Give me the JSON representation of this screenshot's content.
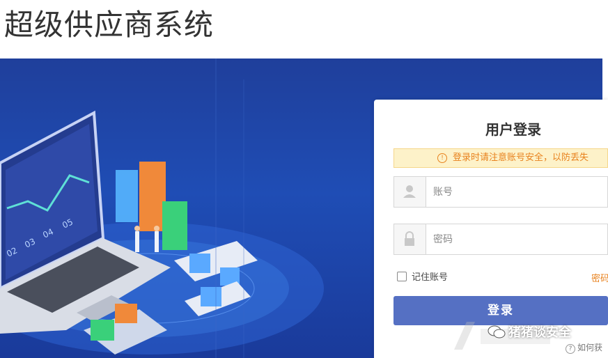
{
  "page": {
    "title": "超级供应商系统"
  },
  "hero": {
    "chart_ticks": [
      "02",
      "03",
      "04",
      "05"
    ]
  },
  "login": {
    "title": "用户登录",
    "notice_icon": "!",
    "notice": "登录时请注意账号安全，以防丢失",
    "username_placeholder": "账号",
    "password_placeholder": "密码",
    "remember_label": "记住账号",
    "forgot_label": "密码",
    "submit_label": "登录"
  },
  "overlay": {
    "brand": "猪猪谈安全",
    "help_icon": "?",
    "help_text": "如何获"
  },
  "colors": {
    "hero_bg": "#1f4db5",
    "notice_bg": "#fdf2c9",
    "accent_orange": "#e8821e",
    "button": "#5570c3"
  }
}
